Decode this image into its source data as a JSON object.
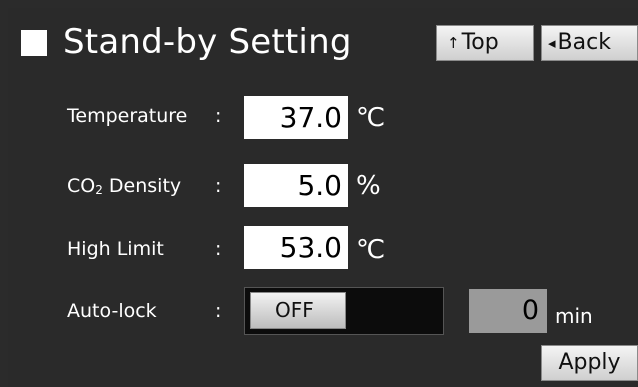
{
  "header": {
    "title": "Stand-by Setting",
    "top_button": {
      "arrow": "↑",
      "label": "Top"
    },
    "back_button": {
      "arrow": "◂",
      "label": "Back"
    }
  },
  "settings": {
    "temperature": {
      "label": "Temperature",
      "colon": ":",
      "value": "37.0",
      "unit": "℃"
    },
    "co2": {
      "label_prefix": "CO",
      "label_sub": "2",
      "label_suffix": " Density",
      "colon": ":",
      "value": "5.0",
      "unit": "%"
    },
    "high_limit": {
      "label": "High Limit",
      "colon": ":",
      "value": "53.0",
      "unit": "℃"
    },
    "auto_lock": {
      "label": "Auto-lock",
      "colon": ":",
      "toggle_state": "OFF",
      "minutes": "0",
      "minutes_unit": "min"
    }
  },
  "footer": {
    "apply_label": "Apply"
  },
  "colors": {
    "background": "#2a2a2a",
    "input_bg": "#ffffff",
    "disabled_input_bg": "#9a9a9a",
    "button_bg": "#e6e6e6"
  },
  "icons": {
    "title_marker": "square",
    "top_arrow": "up-arrow-icon",
    "back_arrow": "left-triangle-icon"
  }
}
